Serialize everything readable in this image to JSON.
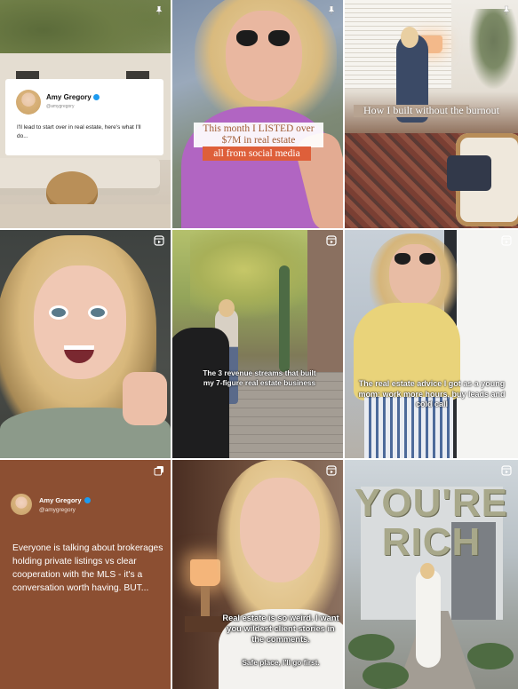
{
  "colors": {
    "tweet_tile_bg": "#8c4f32",
    "verified_badge": "#1d9bf0",
    "overlay_accent": "#de5f3a"
  },
  "icons": {
    "pinned": "pin-icon",
    "reel": "reel-icon",
    "carousel": "carousel-icon"
  },
  "tiles": [
    {
      "badge_icon": "pin-icon",
      "tweet": {
        "name": "Amy Gregory",
        "handle": "@amygregory",
        "text": "I'll lead to start over in real estate, here's what I'll do..."
      }
    },
    {
      "badge_icon": "pin-icon",
      "caption_line1": "This month I LISTED over",
      "caption_line2": "$7M in real estate",
      "caption_line3": "all from social media"
    },
    {
      "badge_icon": "pin-icon",
      "caption": "How I built without the burnout"
    },
    {
      "badge_icon": "reel-icon"
    },
    {
      "badge_icon": "reel-icon",
      "caption": "The 3 revenue streams that built my 7-figure real estate business"
    },
    {
      "badge_icon": "reel-icon",
      "caption": "The real estate advice I got as a young mom: work more hours, buy leads and cold call"
    },
    {
      "badge_icon": "carousel-icon",
      "tweet": {
        "name": "Amy Gregory",
        "handle": "@amygregory",
        "text": "Everyone is talking about brokerages holding private listings vs clear cooperation with the MLS - it's a conversation worth having. BUT..."
      }
    },
    {
      "badge_icon": "reel-icon",
      "caption": "Real estate is so weird. I want you wildest client stories in the comments.",
      "caption_small": "Safe place, I'll go first."
    },
    {
      "badge_icon": "reel-icon",
      "overlay_line1": "YOU'RE",
      "overlay_line2": "RICH"
    }
  ]
}
